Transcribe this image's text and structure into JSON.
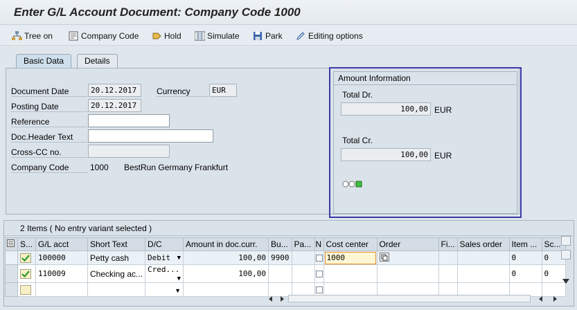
{
  "window": {
    "title": "Enter G/L Account Document: Company Code 1000"
  },
  "toolbar": {
    "tree_on": "Tree on",
    "company_code": "Company Code",
    "hold": "Hold",
    "simulate": "Simulate",
    "park": "Park",
    "editing_options": "Editing options"
  },
  "tabs": {
    "basic_data": "Basic Data",
    "details": "Details"
  },
  "basic": {
    "document_date_label": "Document Date",
    "document_date": "20.12.2017",
    "currency_label": "Currency",
    "currency": "EUR",
    "posting_date_label": "Posting Date",
    "posting_date": "20.12.2017",
    "reference_label": "Reference",
    "reference": "",
    "doc_header_label": "Doc.Header Text",
    "doc_header": "",
    "cross_cc_label": "Cross-CC no.",
    "cross_cc": "",
    "company_code_label": "Company Code",
    "company_code": "1000",
    "company_name": "BestRun Germany Frankfurt"
  },
  "amount": {
    "header": "Amount Information",
    "total_dr_label": "Total Dr.",
    "total_dr": "100,00",
    "total_dr_cur": "EUR",
    "total_cr_label": "Total Cr.",
    "total_cr": "100,00",
    "total_cr_cur": "EUR"
  },
  "items": {
    "title": "2 Items ( No entry variant selected )",
    "columns": [
      "S...",
      "G/L acct",
      "Short Text",
      "D/C",
      "Amount in doc.curr.",
      "Bu...",
      "Pa...",
      "N",
      "Cost center",
      "Order",
      "Fi...",
      "Sales order",
      "Item ...",
      "Sc..."
    ],
    "rows": [
      {
        "gl": "100000",
        "text": "Petty cash",
        "dc": "Debit",
        "amount": "100,00",
        "bu": "9900",
        "cost_center": "1000",
        "item": "0",
        "sc": "0"
      },
      {
        "gl": "110009",
        "text": "Checking ac...",
        "dc": "Cred...",
        "amount": "100,00",
        "bu": "",
        "cost_center": "",
        "item": "0",
        "sc": "0"
      }
    ]
  }
}
